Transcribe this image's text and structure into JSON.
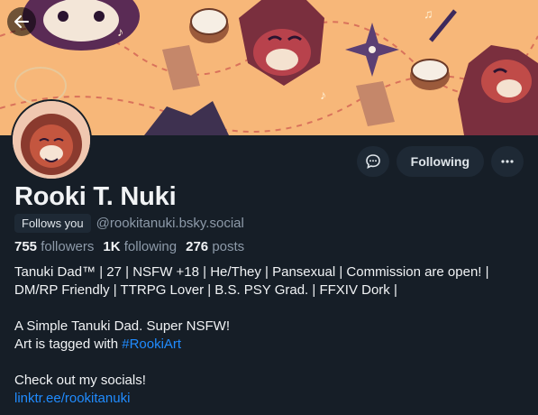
{
  "profile": {
    "display_name": "Rooki T. Nuki",
    "follows_you_label": "Follows you",
    "handle": "@rookitanuki.bsky.social",
    "stats": {
      "followers_count": "755",
      "followers_label": "followers",
      "following_count": "1K",
      "following_label": "following",
      "posts_count": "276",
      "posts_label": "posts"
    }
  },
  "actions": {
    "following_label": "Following",
    "message_icon": "chat-bubble-icon",
    "more_icon": "more-options-icon"
  },
  "nav": {
    "back_icon": "back-arrow-icon"
  },
  "bio": {
    "line1": "Tanuki Dad™ | 27 | NSFW +18 | He/They | Pansexual | Commission are open! |",
    "line2": "DM/RP Friendly | TTRPG Lover | B.S. PSY Grad. | FFXIV Dork |",
    "line3": "A Simple Tanuki Dad. Super NSFW!",
    "line4_prefix": "Art is tagged with ",
    "line4_tag": "#RookiArt",
    "line5": "Check out my socials!",
    "line6_link": "linktr.ee/rookitanuki"
  },
  "colors": {
    "background": "#161e27",
    "link": "#208bfe",
    "secondary_text": "#8d9aa9",
    "button_bg": "#1e2935",
    "banner_bg": "#f7b779"
  }
}
